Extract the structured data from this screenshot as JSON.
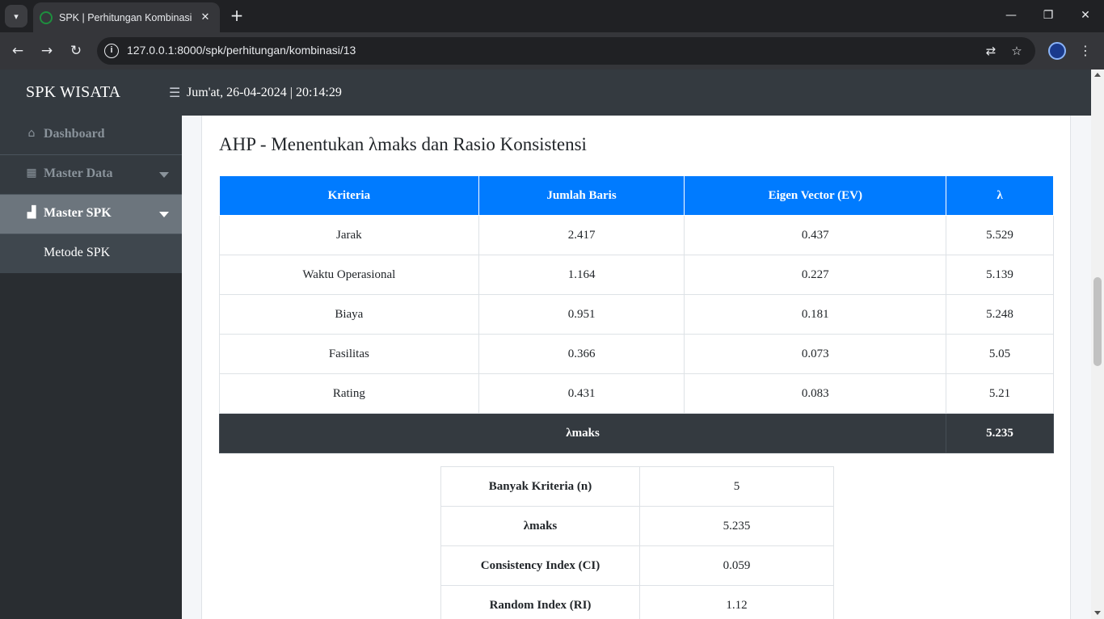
{
  "browser": {
    "tab_title": "SPK | Perhitungan Kombinasi",
    "url": "127.0.0.1:8000/spk/perhitungan/kombinasi/13",
    "icons": {
      "tab_search": "chevron-down-icon",
      "tab_close": "close-icon",
      "new_tab": "plus-icon",
      "minimize": "minimize-icon",
      "restore": "restore-icon",
      "close_window": "close-icon",
      "back": "arrow-left-icon",
      "forward": "arrow-right-icon",
      "reload": "reload-icon",
      "site_info": "info-icon",
      "translate": "translate-icon",
      "bookmark": "star-icon",
      "profile": "avatar-icon",
      "menu": "kebab-menu-icon"
    }
  },
  "navbar": {
    "brand": "SPK WISATA",
    "datetime": "Jum'at, 26-04-2024 | 20:14:29"
  },
  "sidebar": {
    "items": [
      {
        "label": "Dashboard",
        "icon": "home-icon"
      },
      {
        "label": "Master Data",
        "icon": "cubes-icon"
      },
      {
        "label": "Master SPK",
        "icon": "sitemap-icon"
      }
    ],
    "sub_items": [
      {
        "label": "Metode SPK"
      }
    ]
  },
  "card": {
    "title": "AHP - Menentukan λmaks dan Rasio Konsistensi"
  },
  "lambda_table": {
    "headers": [
      "Kriteria",
      "Jumlah Baris",
      "Eigen Vector (EV)",
      "λ"
    ],
    "rows": [
      [
        "Jarak",
        "2.417",
        "0.437",
        "5.529"
      ],
      [
        "Waktu Operasional",
        "1.164",
        "0.227",
        "5.139"
      ],
      [
        "Biaya",
        "0.951",
        "0.181",
        "5.248"
      ],
      [
        "Fasilitas",
        "0.366",
        "0.073",
        "5.05"
      ],
      [
        "Rating",
        "0.431",
        "0.083",
        "5.21"
      ]
    ],
    "footer_label": "λmaks",
    "footer_value": "5.235"
  },
  "summary_table": {
    "rows": [
      [
        "Banyak Kriteria (n)",
        "5"
      ],
      [
        "λmaks",
        "5.235"
      ],
      [
        "Consistency Index (CI)",
        "0.059"
      ],
      [
        "Random Index (RI)",
        "1.12"
      ]
    ]
  },
  "colors": {
    "navbar": "#343a40",
    "table_header": "#007bff",
    "sidebar_active": "#6c757d"
  }
}
